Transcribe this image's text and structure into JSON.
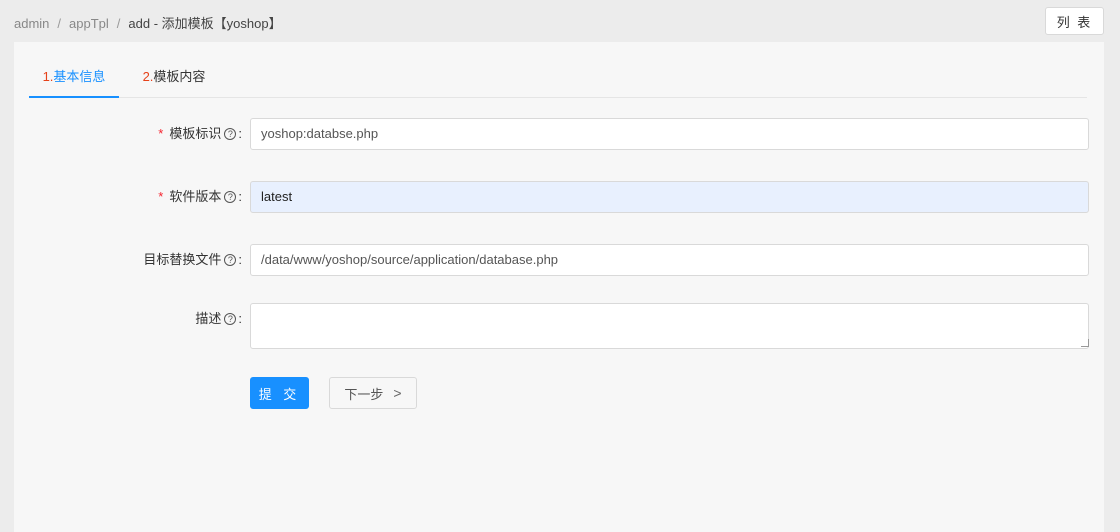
{
  "breadcrumb": {
    "items": [
      "admin",
      "appTpl"
    ],
    "separator": "/",
    "current": "add - 添加模板【yoshop】"
  },
  "header": {
    "list_button": "列 表"
  },
  "tabs": [
    {
      "num": "1.",
      "label": "基本信息"
    },
    {
      "num": "2.",
      "label": "模板内容"
    }
  ],
  "form": {
    "template_id": {
      "label": "模板标识",
      "value": "yoshop:databse.php",
      "required": true
    },
    "software_version": {
      "label": "软件版本",
      "value": "latest",
      "required": true
    },
    "target_file": {
      "label": "目标替换文件",
      "value": "/data/www/yoshop/source/application/database.php",
      "required": false
    },
    "description": {
      "label": "描述",
      "value": "",
      "required": false
    },
    "required_mark": "*",
    "help_mark": "?",
    "colon": ":"
  },
  "actions": {
    "submit_label": "提 交",
    "next_label": "下一步",
    "next_chevron": ">"
  },
  "colors": {
    "primary": "#1890ff",
    "required": "#f5222d",
    "tab_number": "#e6421a",
    "autofill_bg": "#e8f0fe"
  }
}
